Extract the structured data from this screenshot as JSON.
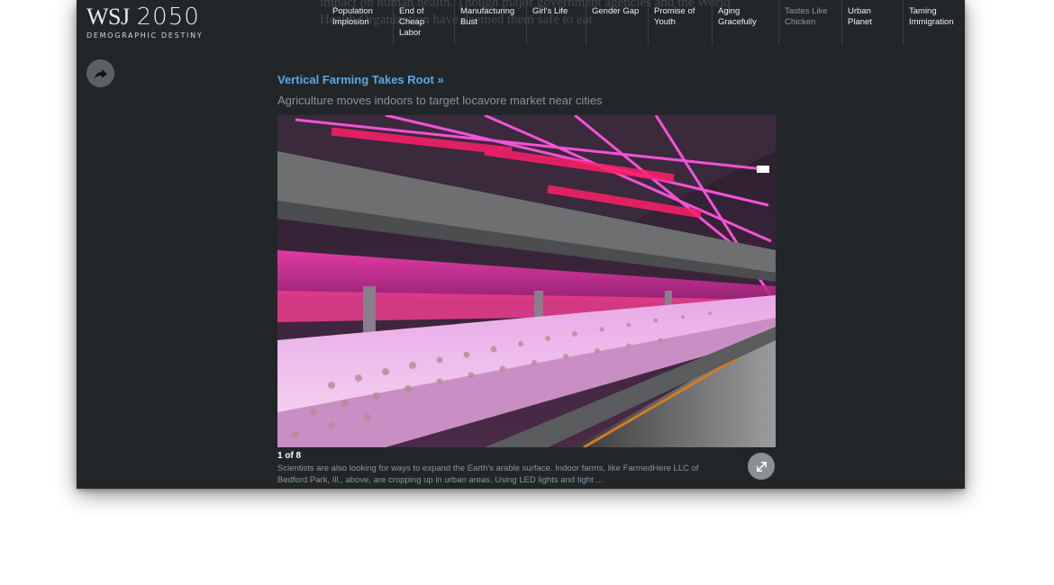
{
  "background_text": "impact on human health. Though major government agencies and the World Health Organization have deemed them safe to eat",
  "logo": {
    "main": "WSJ",
    "number": "2050",
    "subtitle": "DEMOGRAPHIC DESTINY"
  },
  "nav": {
    "items": [
      {
        "label": "Population\nImplosion"
      },
      {
        "label": "End of Cheap\nLabor"
      },
      {
        "label": "Manufacturing\nBust"
      },
      {
        "label": "Girl's Life"
      },
      {
        "label": "Gender Gap"
      },
      {
        "label": "Promise of\nYouth"
      },
      {
        "label": "Aging\nGracefully"
      },
      {
        "label": "Tastes Like\nChicken",
        "state": "current"
      },
      {
        "label": "Urban Planet"
      },
      {
        "label": "Taming\nImmigration"
      }
    ]
  },
  "share": {
    "icon": "share-arrow-icon"
  },
  "article": {
    "headline": "Vertical Farming Takes Root »",
    "subhead": "Agriculture moves indoors to target locavore market near cities"
  },
  "slideshow": {
    "counter": "1 of 8",
    "caption": "Scientists are also looking for ways to expand the Earth's arable surface. Indoor farms, like FarmedHere LLC of Bedford Park, Ill., above, are cropping up in urban areas. Using LED lights and tight ...",
    "expand_icon": "expand-arrows-icon"
  },
  "colors": {
    "panel": "#222628",
    "link": "#5aa9e6",
    "muted_text": "#8b9296",
    "led_magenta": "#e040b0"
  }
}
